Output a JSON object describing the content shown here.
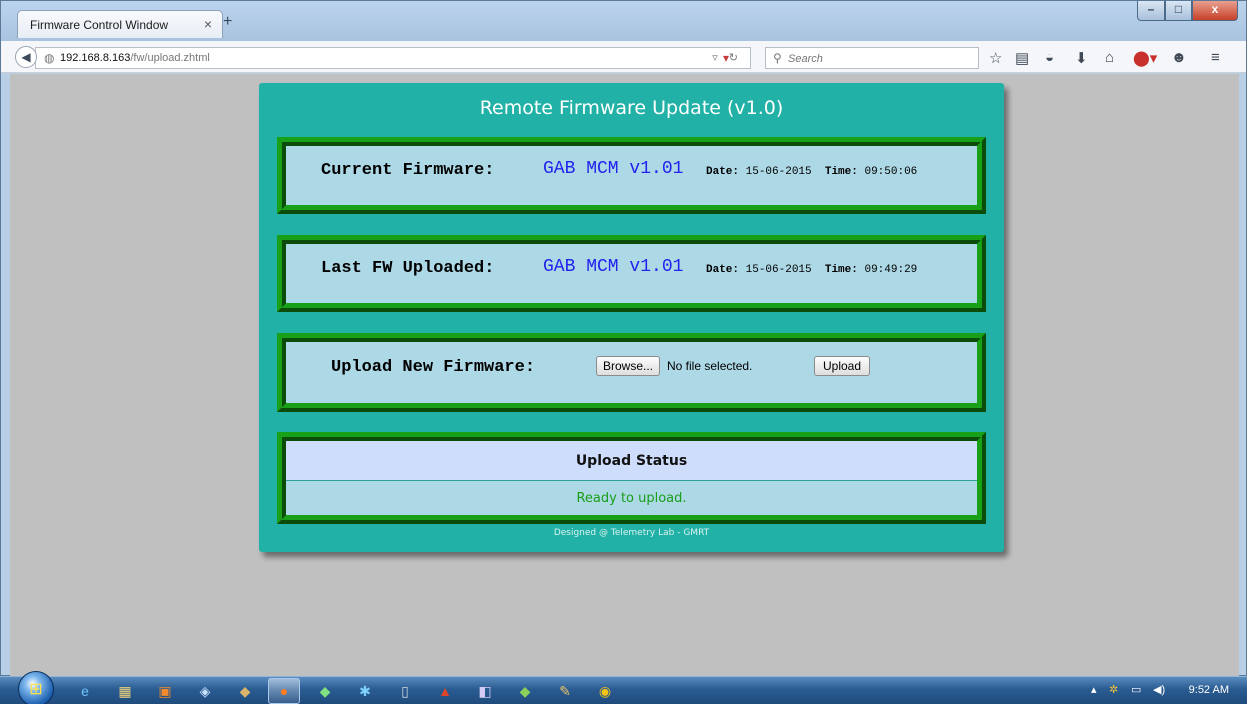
{
  "browser": {
    "tab_title": "Firmware Control Window",
    "tab_close": "×",
    "new_tab": "+",
    "url_host": "192.168.8.163",
    "url_path": "/fw/upload.zhtml",
    "search_placeholder": "Search",
    "window_controls": {
      "minimize": "–",
      "maximize": "□",
      "close": "x"
    }
  },
  "page": {
    "title": "Remote Firmware Update (v1.0)",
    "current": {
      "label": "Current Firmware:",
      "version": "GAB MCM v1.01",
      "date_label": "Date:",
      "date": "15-06-2015",
      "time_label": "Time:",
      "time": "09:50:06"
    },
    "last": {
      "label": "Last FW Uploaded:",
      "version": "GAB MCM v1.01",
      "date_label": "Date:",
      "date": "15-06-2015",
      "time_label": "Time:",
      "time": "09:49:29"
    },
    "upload": {
      "label": "Upload New Firmware:",
      "browse_label": "Browse...",
      "file_status": "No file selected.",
      "upload_label": "Upload"
    },
    "status": {
      "heading": "Upload Status",
      "message": "Ready to upload."
    },
    "footer": "Designed @ Telemetry Lab - GMRT"
  },
  "taskbar": {
    "clock": "9:52 AM"
  }
}
